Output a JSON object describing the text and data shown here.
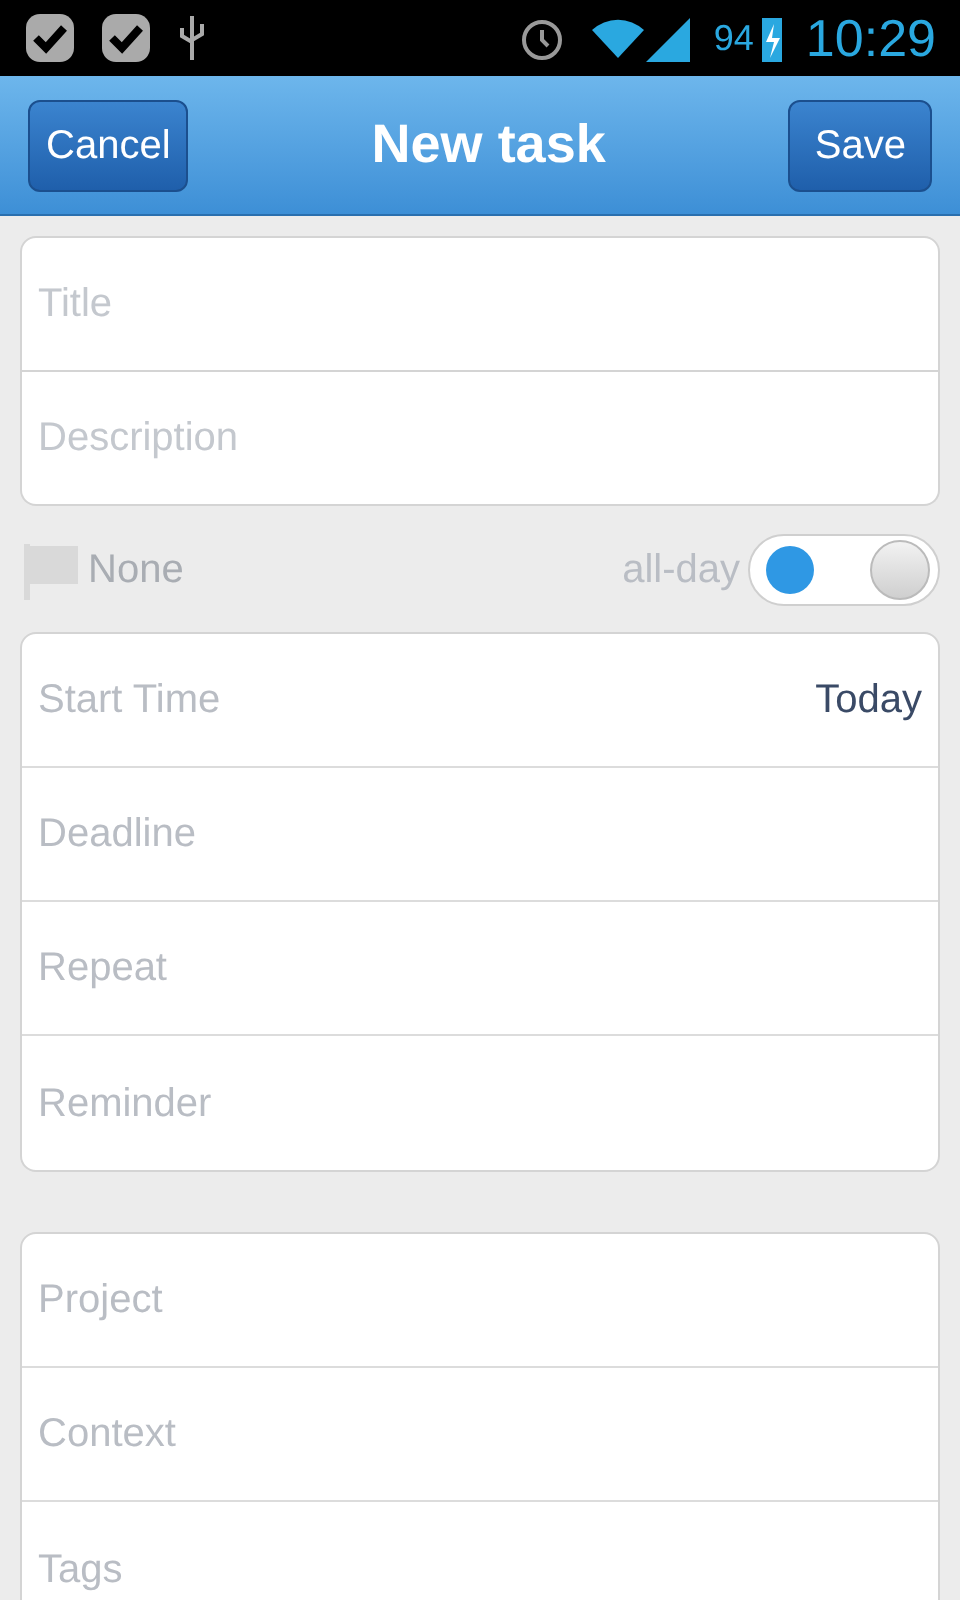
{
  "status_bar": {
    "battery": "94",
    "time": "10:29"
  },
  "header": {
    "cancel": "Cancel",
    "title": "New task",
    "save": "Save"
  },
  "details": [
    {
      "placeholder": "Title"
    },
    {
      "placeholder": "Description"
    }
  ],
  "priority": {
    "label": "None"
  },
  "all_day": {
    "label": "all-day",
    "on": false
  },
  "schedule": [
    {
      "label": "Start Time",
      "value": "Today"
    },
    {
      "label": "Deadline"
    },
    {
      "label": "Repeat"
    },
    {
      "label": "Reminder"
    }
  ],
  "organize": [
    {
      "label": "Project"
    },
    {
      "label": "Context"
    },
    {
      "label": "Tags"
    }
  ]
}
